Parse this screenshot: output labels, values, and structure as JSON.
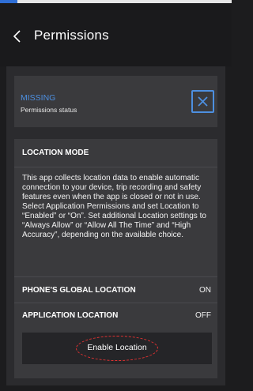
{
  "header": {
    "title": "Permissions",
    "back_icon": "chevron-left-icon"
  },
  "status": {
    "state": "MISSING",
    "label": "Permissions status",
    "icon": "close-icon"
  },
  "location_mode": {
    "title": "LOCATION MODE",
    "description": "This app collects location data to enable automatic connection to your device, trip recording and safety features even when the app is closed or not in use. Select Application Permissions and set Location to “Enabled” or “On”. Set additional Location settings to “Always Allow” or “Allow All The Time” and “High Accuracy”, depending on the available choice.",
    "rows": [
      {
        "label": "PHONE'S GLOBAL LOCATION",
        "value": "ON"
      },
      {
        "label": "APPLICATION LOCATION",
        "value": "OFF"
      }
    ],
    "button_label": "Enable Location"
  },
  "colors": {
    "accent": "#4d8fe0",
    "background": "#1c1c1e",
    "card": "#3a3a3d",
    "highlight": "#e63232"
  }
}
